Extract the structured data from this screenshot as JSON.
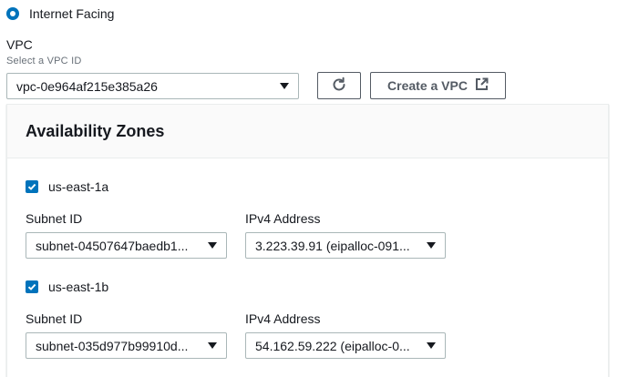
{
  "scheme": {
    "selected_label": "Internet Facing"
  },
  "vpc": {
    "label": "VPC",
    "description": "Select a VPC ID",
    "selected_value": "vpc-0e964af215e385a26",
    "create_button_label": "Create a VPC"
  },
  "availability_zones": {
    "title": "Availability Zones",
    "subnet_label": "Subnet ID",
    "ipv4_label": "IPv4 Address",
    "zones": [
      {
        "name": "us-east-1a",
        "checked": true,
        "subnet_value": "subnet-04507647baedb1...",
        "ipv4_value": "3.223.39.91 (eipalloc-091..."
      },
      {
        "name": "us-east-1b",
        "checked": true,
        "subnet_value": "subnet-035d977b99910d...",
        "ipv4_value": "54.162.59.222 (eipalloc-0..."
      }
    ]
  },
  "colors": {
    "accent": "#0073bb",
    "border": "#aab7b8",
    "button_border": "#545b64",
    "panel_header_bg": "#fafafa"
  },
  "icons": [
    "radio-selected-icon",
    "chevron-down-icon",
    "refresh-icon",
    "external-link-icon",
    "checkbox-checked-icon"
  ]
}
